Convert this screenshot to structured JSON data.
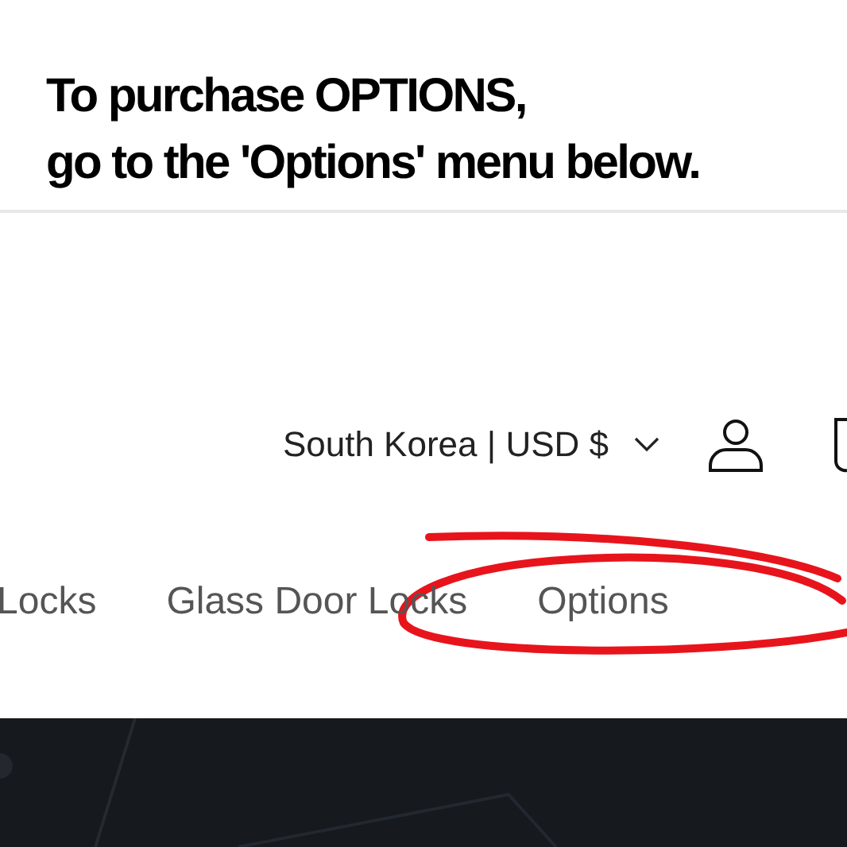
{
  "headline": [
    "To purchase **OPTIONS**,",
    "go to the 'Options' menu below."
  ],
  "header": {
    "locale": "South Korea | USD $"
  },
  "nav": [
    {
      "label": "Locks"
    },
    {
      "label": "Glass Door Locks"
    },
    {
      "label": "Options"
    }
  ],
  "hero": {
    "kind": "picture"
  }
}
